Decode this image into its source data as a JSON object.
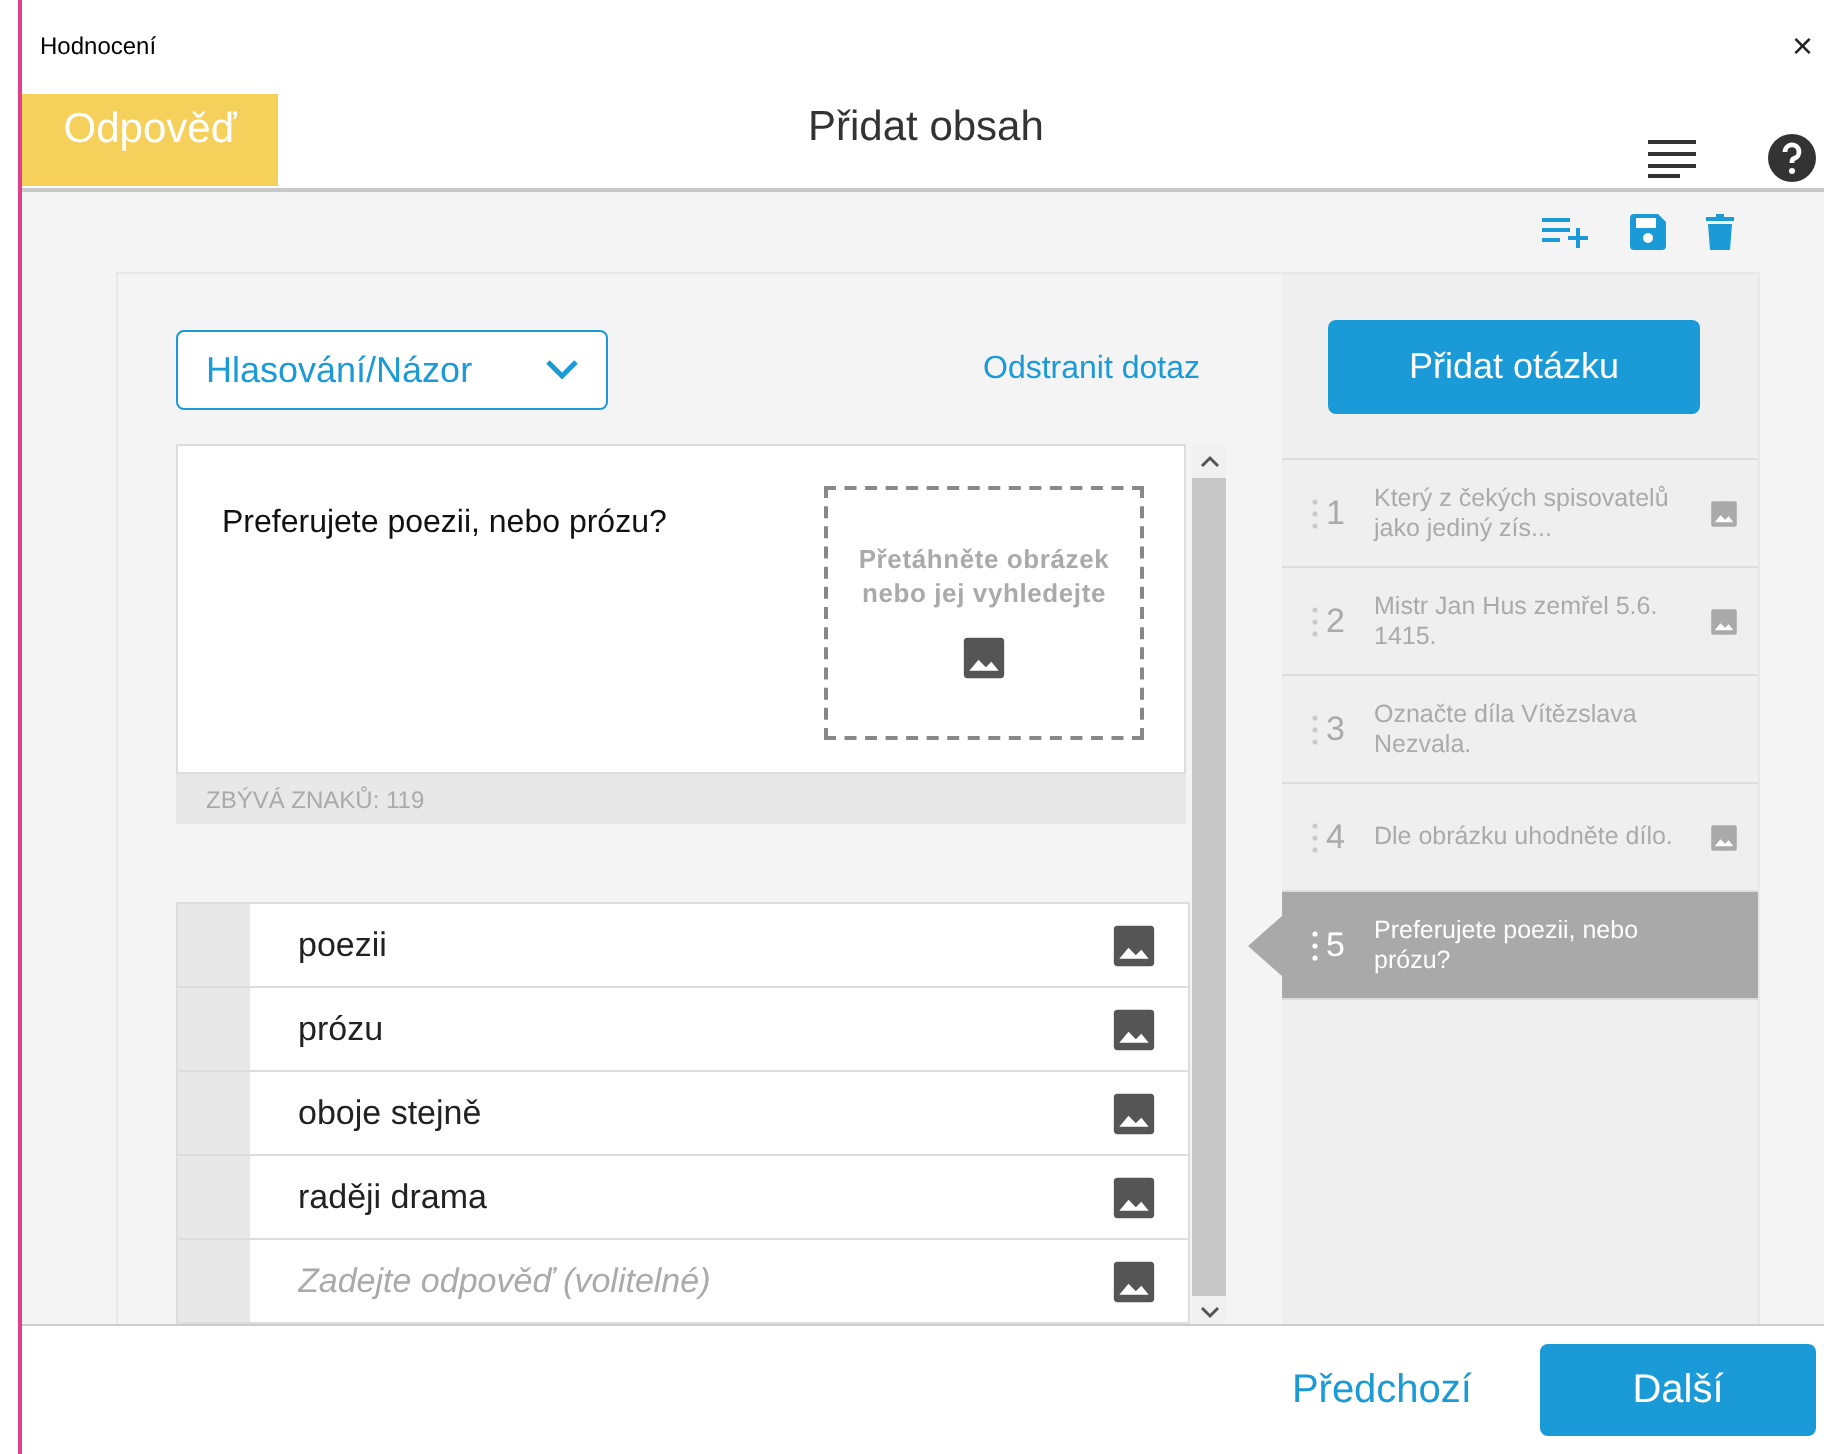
{
  "window": {
    "title": "Hodnocení",
    "close": "×"
  },
  "header": {
    "tab": "Odpověď",
    "title": "Přidat obsah"
  },
  "editor": {
    "type_dropdown": "Hlasování/Názor",
    "remove_link": "Odstranit dotaz",
    "question": "Preferujete poezii, nebo prózu?",
    "drop_hint": "Přetáhněte obrázek nebo jej vyhledejte",
    "chars_left": "ZBÝVÁ ZNAKŮ: 119",
    "answers": [
      {
        "text": "poezii"
      },
      {
        "text": "prózu"
      },
      {
        "text": "oboje stejně"
      },
      {
        "text": "raději drama"
      },
      {
        "placeholder": "Zadejte odpověď (volitelné)"
      }
    ]
  },
  "sidebar": {
    "add_button": "Přidat otázku",
    "questions": [
      {
        "number": "1",
        "text": "Který z čekých spisovatelů jako jediný zís...",
        "has_image": true,
        "selected": false
      },
      {
        "number": "2",
        "text": "Mistr Jan Hus zemřel 5.6. 1415.",
        "has_image": true,
        "selected": false
      },
      {
        "number": "3",
        "text": "Označte díla Vítězslava Nezvala.",
        "has_image": false,
        "selected": false
      },
      {
        "number": "4",
        "text": "Dle obrázku uhodněte dílo.",
        "has_image": true,
        "selected": false
      },
      {
        "number": "5",
        "text": "Preferujete poezii, nebo prózu?",
        "has_image": false,
        "selected": true
      }
    ]
  },
  "footer": {
    "previous": "Předchozí",
    "next": "Další"
  }
}
